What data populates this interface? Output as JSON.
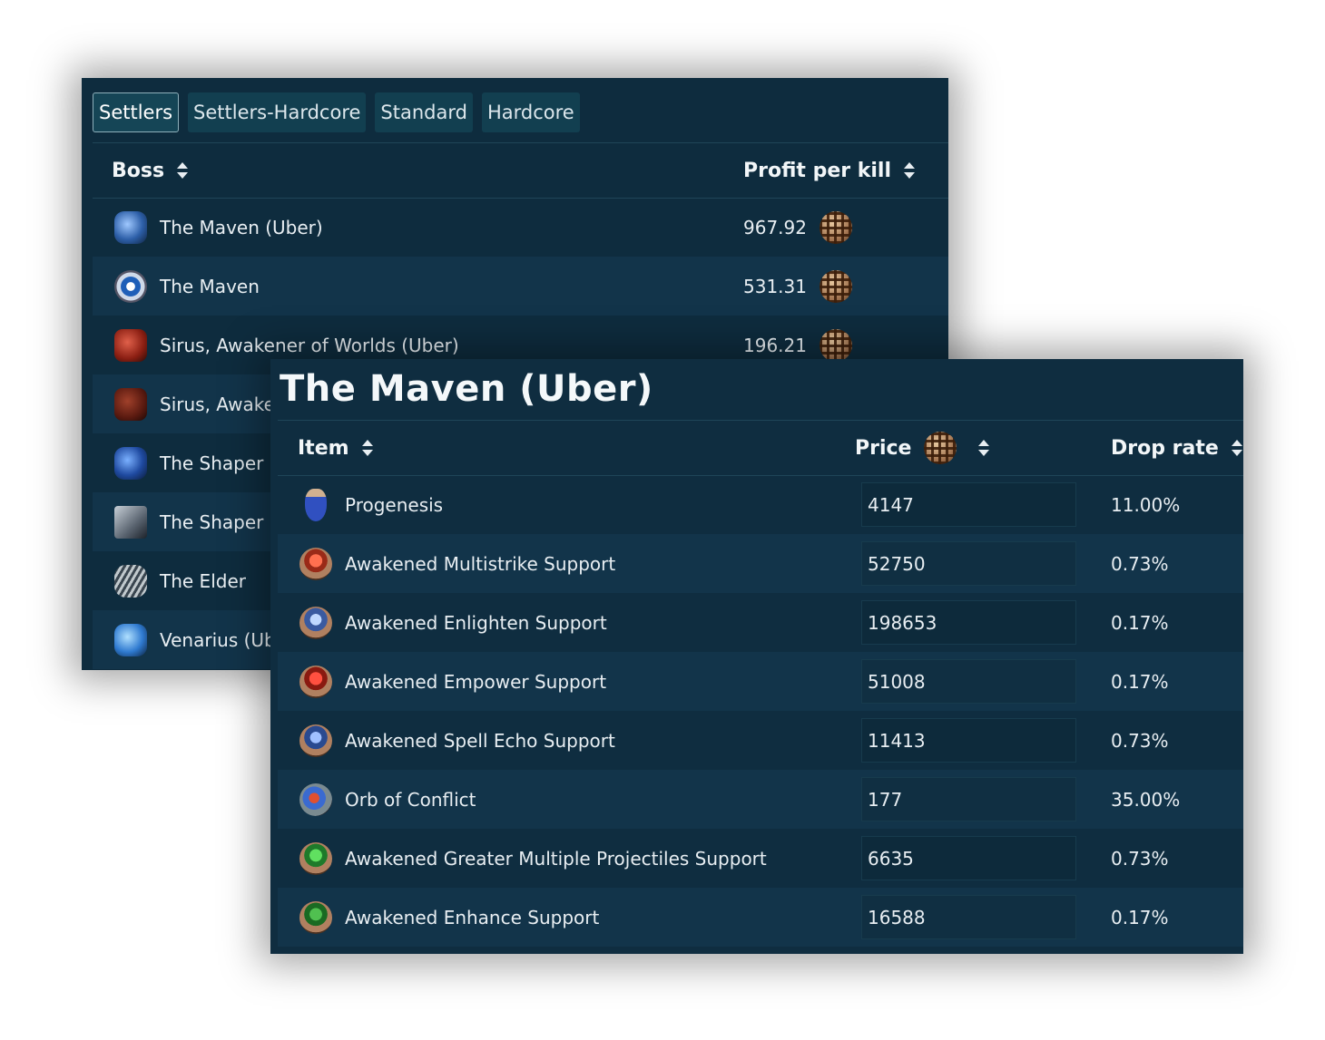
{
  "boss_panel": {
    "tabs": [
      {
        "label": "Settlers",
        "active": true
      },
      {
        "label": "Settlers-Hardcore",
        "active": false
      },
      {
        "label": "Standard",
        "active": false
      },
      {
        "label": "Hardcore",
        "active": false
      }
    ],
    "columns": {
      "boss": "Boss",
      "profit": "Profit per kill"
    },
    "rows": [
      {
        "name": "The Maven (Uber)",
        "profit": "967.92",
        "icon": "maven-uber-icon"
      },
      {
        "name": "The Maven",
        "profit": "531.31",
        "icon": "maven-eye-icon"
      },
      {
        "name": "Sirus, Awakener of Worlds (Uber)",
        "profit": "196.21",
        "icon": "sirus-uber-icon"
      },
      {
        "name": "Sirus, Awake",
        "profit": "",
        "icon": "sirus-icon"
      },
      {
        "name": "The Shaper",
        "profit": "",
        "icon": "shaper-uber-icon"
      },
      {
        "name": "The Shaper",
        "profit": "",
        "icon": "shaper-icon"
      },
      {
        "name": "The Elder",
        "profit": "",
        "icon": "elder-icon"
      },
      {
        "name": "Venarius (Ub",
        "profit": "",
        "icon": "venarius-icon"
      }
    ]
  },
  "drop_panel": {
    "title": "The Maven (Uber)",
    "columns": {
      "item": "Item",
      "price": "Price",
      "drop_rate": "Drop rate"
    },
    "rows": [
      {
        "item": "Progenesis",
        "price": "4147",
        "drop_rate": "11.00%",
        "icon": "flask-icon"
      },
      {
        "item": "Awakened Multistrike Support",
        "price": "52750",
        "drop_rate": "0.73%",
        "icon": "red-gem-icon"
      },
      {
        "item": "Awakened Enlighten Support",
        "price": "198653",
        "drop_rate": "0.17%",
        "icon": "blue-gem-icon"
      },
      {
        "item": "Awakened Empower Support",
        "price": "51008",
        "drop_rate": "0.17%",
        "icon": "red-gem-icon"
      },
      {
        "item": "Awakened Spell Echo Support",
        "price": "11413",
        "drop_rate": "0.73%",
        "icon": "blue-gem-icon"
      },
      {
        "item": "Orb of Conflict",
        "price": "177",
        "drop_rate": "35.00%",
        "icon": "orb-icon"
      },
      {
        "item": "Awakened Greater Multiple Projectiles Support",
        "price": "6635",
        "drop_rate": "0.73%",
        "icon": "green-gem-icon"
      },
      {
        "item": "Awakened Enhance Support",
        "price": "16588",
        "drop_rate": "0.17%",
        "icon": "green-gem-icon"
      }
    ]
  },
  "colors": {
    "panel_bg": "#0f2d40",
    "row_alt": "#12344a",
    "tab_bg": "#123f50",
    "text": "#e8eef2"
  }
}
